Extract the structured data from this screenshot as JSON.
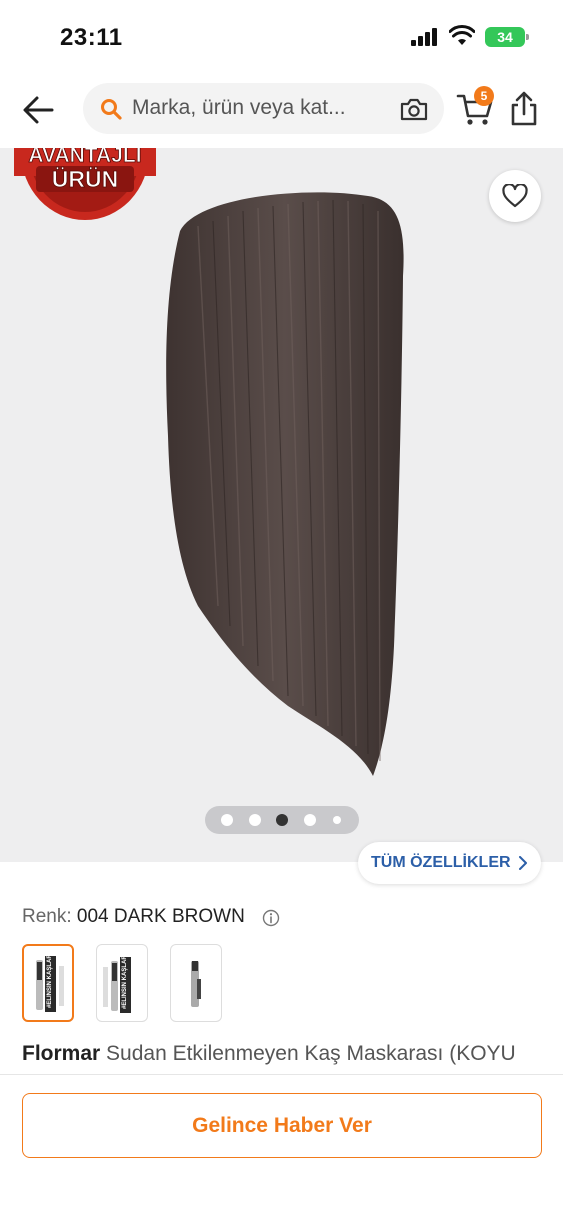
{
  "status_bar": {
    "time": "23:11",
    "battery": "34"
  },
  "header": {
    "search_placeholder": "Marka, ürün veya kat...",
    "cart_count": "5"
  },
  "gallery": {
    "promo_badge": {
      "line1": "AVANTAJLI",
      "line2": "ÜRÜN"
    },
    "page_count": 5,
    "active_page": 3
  },
  "features": {
    "label": "TÜM ÖZELLİKLER"
  },
  "color": {
    "label": "Renk:",
    "value": "004 DARK BROWN"
  },
  "variants": [
    {
      "text": "#ELINSIN KAŞLAR",
      "selected": true
    },
    {
      "text": "#ELINSIN KAŞLAR",
      "selected": false
    },
    {
      "text": "",
      "selected": false
    }
  ],
  "product": {
    "brand": "Flormar",
    "name": "Sudan Etkilenmeyen Kaş Maskarası (KOYU"
  },
  "notify": {
    "label": "Gelince Haber Ver"
  },
  "colors": {
    "accent": "#f27a1a",
    "link": "#2c5fa8",
    "swatch": "#4b3f3c",
    "badge_red": "#c8281e"
  }
}
